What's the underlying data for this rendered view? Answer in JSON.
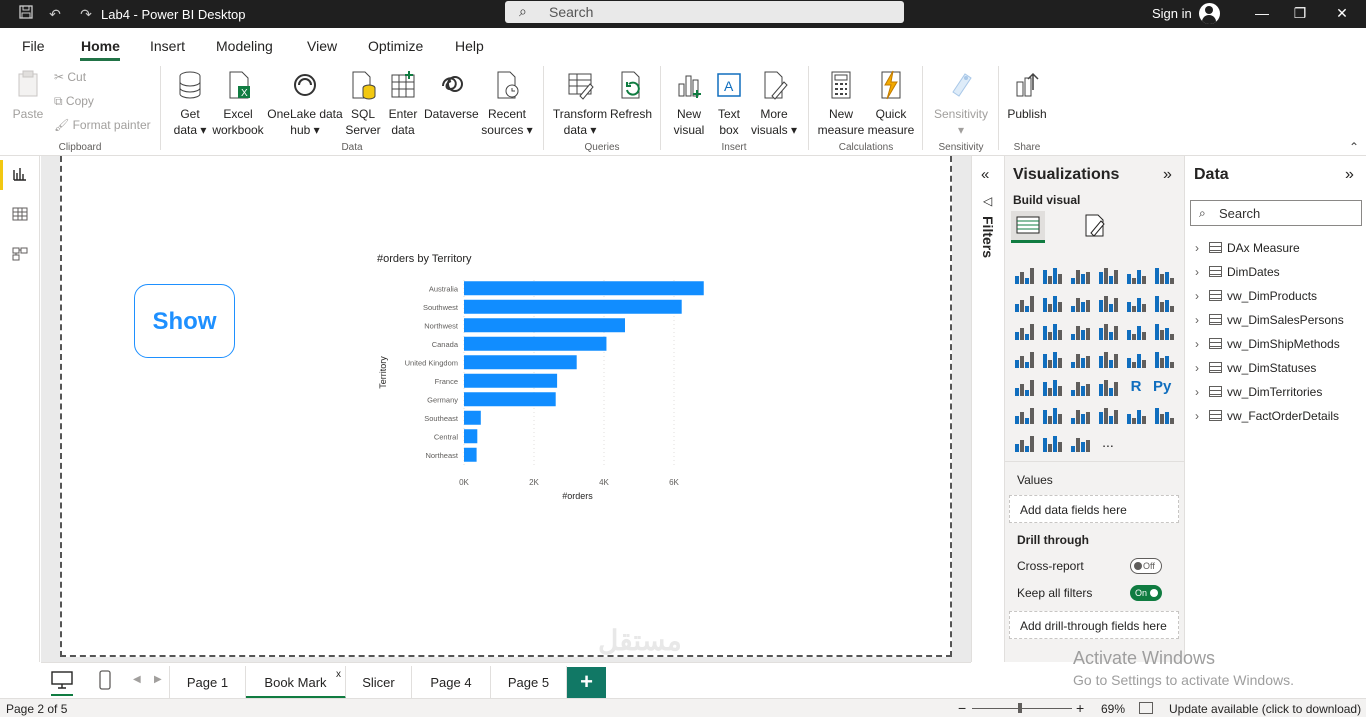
{
  "window": {
    "title": "Lab4 - Power BI Desktop",
    "search_placeholder": "Search",
    "sign_in": "Sign in"
  },
  "menu": [
    "File",
    "Home",
    "Insert",
    "Modeling",
    "View",
    "Optimize",
    "Help"
  ],
  "active_menu": "Home",
  "ribbon": {
    "clipboard": {
      "paste": "Paste",
      "cut": "Cut",
      "copy": "Copy",
      "format_painter": "Format painter",
      "label": "Clipboard"
    },
    "data": {
      "get_data_1": "Get",
      "get_data_2": "data",
      "excel_1": "Excel",
      "excel_2": "workbook",
      "onelake_1": "OneLake data",
      "onelake_2": "hub",
      "sql_1": "SQL",
      "sql_2": "Server",
      "enter_1": "Enter",
      "enter_2": "data",
      "dataverse": "Dataverse",
      "recent_1": "Recent",
      "recent_2": "sources",
      "label": "Data"
    },
    "queries": {
      "transform_1": "Transform",
      "transform_2": "data",
      "refresh": "Refresh",
      "label": "Queries"
    },
    "insert": {
      "new_visual_1": "New",
      "new_visual_2": "visual",
      "text_box_1": "Text",
      "text_box_2": "box",
      "more_visuals_1": "More",
      "more_visuals_2": "visuals",
      "label": "Insert"
    },
    "calculations": {
      "new_measure_1": "New",
      "new_measure_2": "measure",
      "quick_measure_1": "Quick",
      "quick_measure_2": "measure",
      "label": "Calculations"
    },
    "sensitivity": {
      "button": "Sensitivity",
      "label": "Sensitivity"
    },
    "share": {
      "publish": "Publish",
      "label": "Share"
    }
  },
  "canvas": {
    "show_button": "Show"
  },
  "chart_data": {
    "type": "bar",
    "orientation": "horizontal",
    "title": "#orders by Territory",
    "xlabel": "#orders",
    "ylabel": "Territory",
    "categories": [
      "Australia",
      "Southwest",
      "Northwest",
      "Canada",
      "United Kingdom",
      "France",
      "Germany",
      "Southeast",
      "Central",
      "Northeast"
    ],
    "values": [
      6850,
      6220,
      4600,
      4070,
      3220,
      2660,
      2620,
      480,
      380,
      360
    ],
    "xlim": [
      0,
      7000
    ],
    "xticks": [
      "0K",
      "2K",
      "4K",
      "6K"
    ],
    "xtick_values": [
      0,
      2000,
      4000,
      6000
    ],
    "color": "#118dff"
  },
  "filters": {
    "label": "Filters"
  },
  "visualizations": {
    "title": "Visualizations",
    "build_visual": "Build visual",
    "values_label": "Values",
    "values_drop": "Add data fields here",
    "drill_through": "Drill through",
    "cross_report": "Cross-report",
    "cross_report_state": "Off",
    "keep_filters": "Keep all filters",
    "keep_filters_state": "On",
    "drill_drop": "Add drill-through fields here",
    "more": "..."
  },
  "data_pane": {
    "title": "Data",
    "search_placeholder": "Search",
    "fields": [
      "DAx Measure",
      "DimDates",
      "vw_DimProducts",
      "vw_DimSalesPersons",
      "vw_DimShipMethods",
      "vw_DimStatuses",
      "vw_DimTerritories",
      "vw_FactOrderDetails"
    ]
  },
  "pages": {
    "tabs": [
      "Page 1",
      "Book Mark",
      "Slicer",
      "Page 4",
      "Page 5"
    ],
    "active": "Book Mark",
    "close": "x",
    "add": "+"
  },
  "status": {
    "page": "Page 2 of 5",
    "zoom": "69%",
    "update": "Update available (click to download)",
    "activate_title": "Activate Windows",
    "activate_sub": "Go to Settings to activate Windows."
  }
}
